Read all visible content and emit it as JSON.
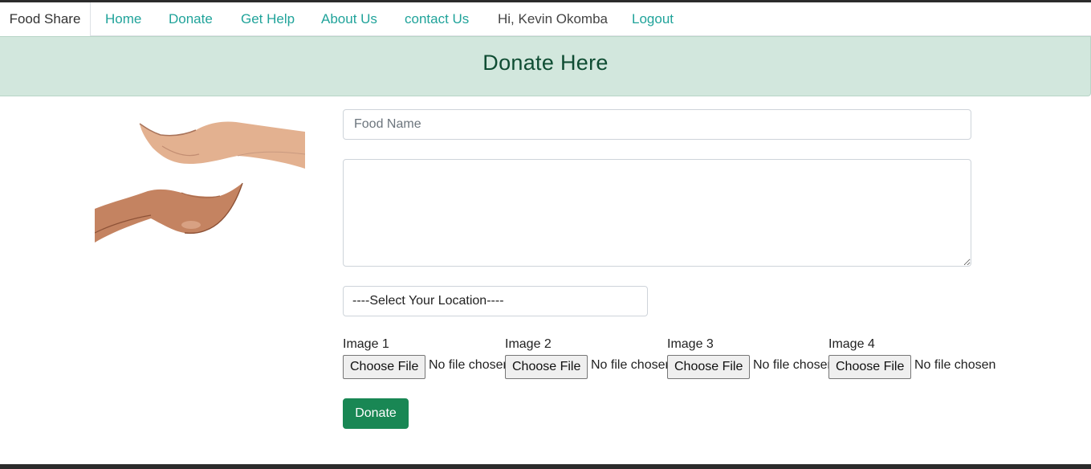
{
  "navbar": {
    "brand": "Food Share",
    "links": [
      "Home",
      "Donate",
      "Get Help",
      "About Us",
      "contact Us"
    ],
    "greeting": "Hi, Kevin Okomba",
    "logout": "Logout"
  },
  "banner": {
    "title": "Donate Here"
  },
  "form": {
    "food_name_placeholder": "Food Name",
    "description_value": "",
    "location_selected": "----Select Your Location----",
    "images": [
      {
        "label": "Image 1",
        "button": "Choose File",
        "status": "No file chosen"
      },
      {
        "label": "Image 2",
        "button": "Choose File",
        "status": "No file chosen"
      },
      {
        "label": "Image 3",
        "button": "Choose File",
        "status": "No file chosen"
      },
      {
        "label": "Image 4",
        "button": "Choose File",
        "status": "No file chosen"
      }
    ],
    "submit_label": "Donate"
  },
  "colors": {
    "link": "#20a39a",
    "banner_bg": "#d2e7dd",
    "banner_text": "#0f4d33",
    "button_green": "#198754"
  }
}
